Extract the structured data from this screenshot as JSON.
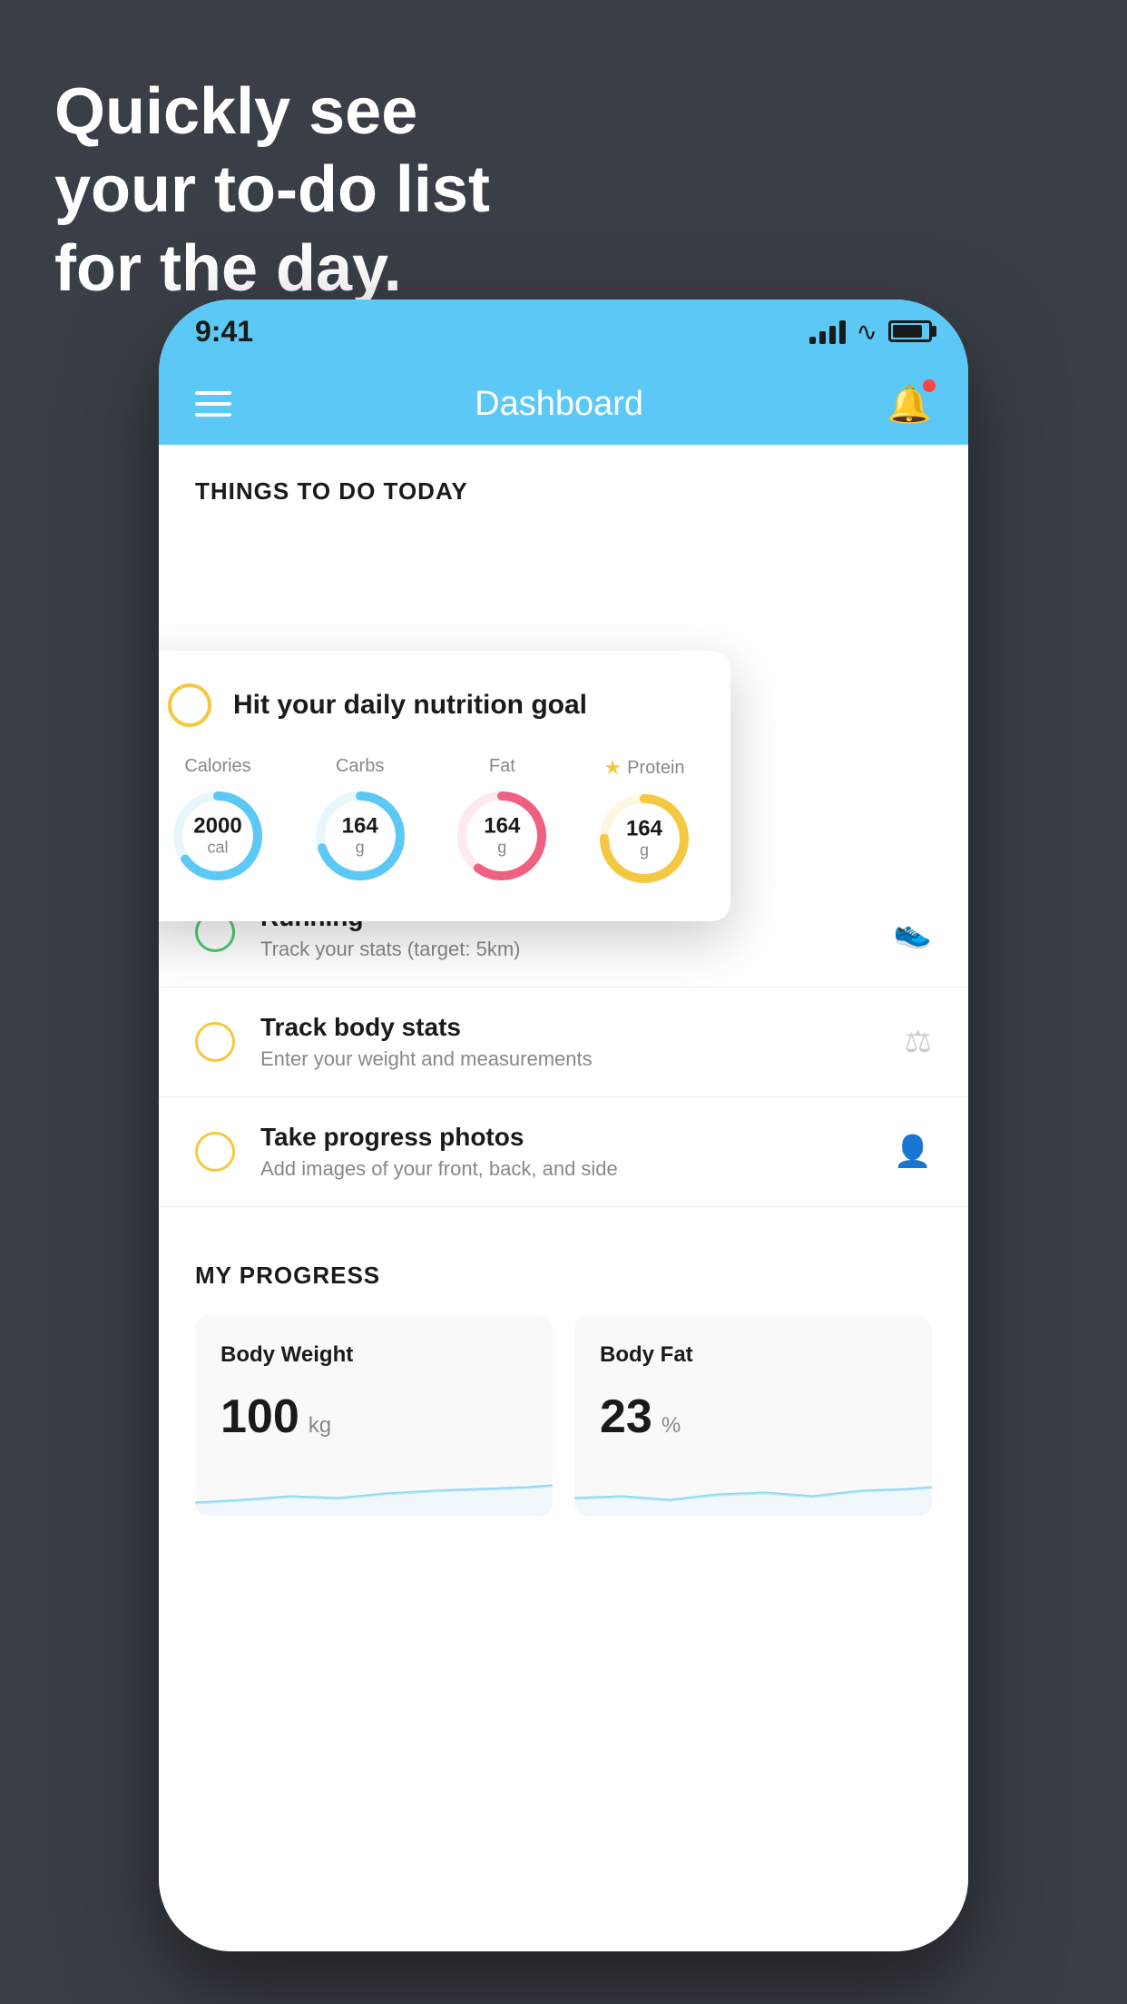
{
  "page": {
    "background_color": "#3a3f47",
    "headline": {
      "line1": "Quickly see",
      "line2": "your to-do list",
      "line3": "for the day."
    }
  },
  "status_bar": {
    "time": "9:41",
    "background": "#5bc8f5"
  },
  "app_header": {
    "title": "Dashboard",
    "background": "#5bc8f5"
  },
  "things_to_do": {
    "section_title": "THINGS TO DO TODAY",
    "nutrition_card": {
      "title": "Hit your daily nutrition goal",
      "stats": [
        {
          "label": "Calories",
          "value": "2000",
          "unit": "cal",
          "color": "#5bc8f5",
          "progress": 65
        },
        {
          "label": "Carbs",
          "value": "164",
          "unit": "g",
          "color": "#5bc8f5",
          "progress": 70
        },
        {
          "label": "Fat",
          "value": "164",
          "unit": "g",
          "color": "#f06080",
          "progress": 60
        },
        {
          "label": "Protein",
          "value": "164",
          "unit": "g",
          "color": "#f5c842",
          "progress": 75,
          "starred": true
        }
      ]
    },
    "items": [
      {
        "id": "running",
        "title": "Running",
        "subtitle": "Track your stats (target: 5km)",
        "circle_color": "green",
        "icon": "👟"
      },
      {
        "id": "body-stats",
        "title": "Track body stats",
        "subtitle": "Enter your weight and measurements",
        "circle_color": "yellow",
        "icon": "⚖"
      },
      {
        "id": "progress-photos",
        "title": "Take progress photos",
        "subtitle": "Add images of your front, back, and side",
        "circle_color": "yellow",
        "icon": "👤"
      }
    ]
  },
  "my_progress": {
    "section_title": "MY PROGRESS",
    "cards": [
      {
        "id": "body-weight",
        "title": "Body Weight",
        "value": "100",
        "unit": "kg"
      },
      {
        "id": "body-fat",
        "title": "Body Fat",
        "value": "23",
        "unit": "%"
      }
    ]
  }
}
